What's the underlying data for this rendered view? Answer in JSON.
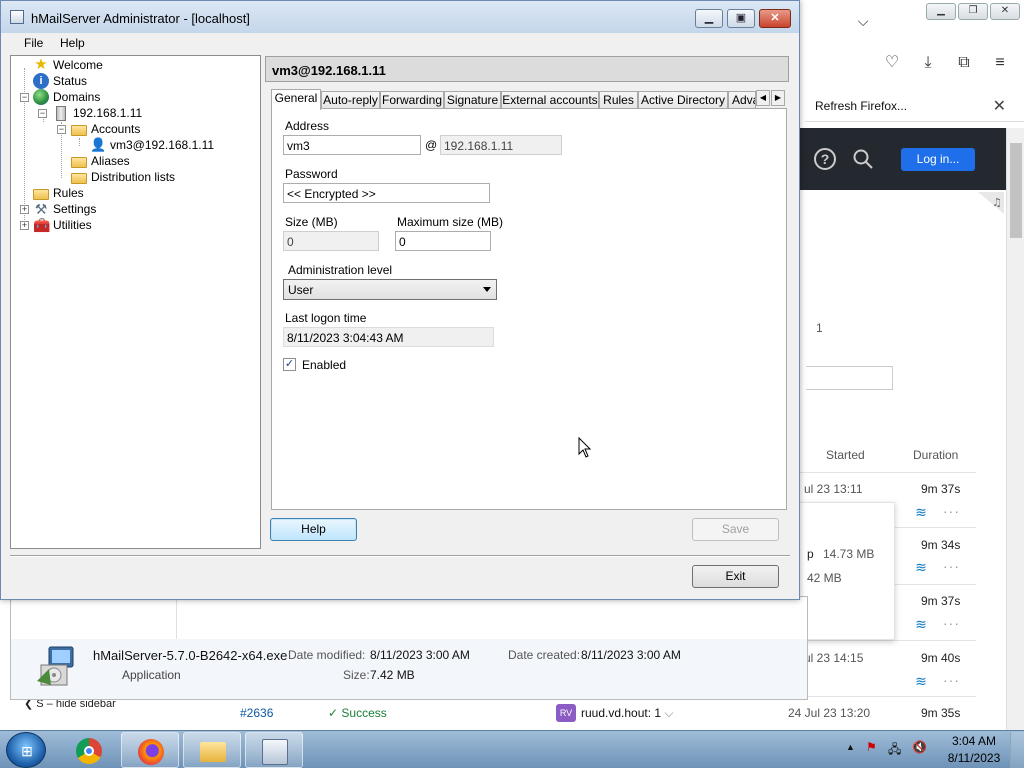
{
  "app": {
    "title": "hMailServer Administrator - [localhost]",
    "menu": [
      "File",
      "Help"
    ]
  },
  "tree": {
    "items": [
      {
        "label": "Welcome",
        "icon": "star-icon"
      },
      {
        "label": "Status",
        "icon": "info-icon"
      },
      {
        "label": "Domains",
        "icon": "globe-icon"
      },
      {
        "label": "192.168.1.11",
        "icon": "server-icon"
      },
      {
        "label": "Accounts",
        "icon": "folder-icon"
      },
      {
        "label": "vm3@192.168.1.11",
        "icon": "user-icon"
      },
      {
        "label": "Aliases",
        "icon": "folder-icon"
      },
      {
        "label": "Distribution lists",
        "icon": "folder-icon"
      },
      {
        "label": "Rules",
        "icon": "folder-icon"
      },
      {
        "label": "Settings",
        "icon": "tools-icon"
      },
      {
        "label": "Utilities",
        "icon": "utilities-icon"
      }
    ]
  },
  "account": {
    "header": "vm3@192.168.1.11",
    "tabs": [
      "General",
      "Auto-reply",
      "Forwarding",
      "Signature",
      "External accounts",
      "Rules",
      "Active Directory",
      "Adva"
    ],
    "active_tab": "General",
    "address_label": "Address",
    "address_value": "vm3",
    "at_sign": "@",
    "domain_value": "192.168.1.11",
    "password_label": "Password",
    "password_value": "<< Encrypted >>",
    "size_label": "Size (MB)",
    "size_value": "0",
    "max_size_label": "Maximum size (MB)",
    "max_size_value": "0",
    "admin_level_label": "Administration level",
    "admin_level_value": "User",
    "last_logon_label": "Last logon time",
    "last_logon_value": "8/11/2023 3:04:43 AM",
    "enabled_label": "Enabled",
    "enabled": true
  },
  "buttons": {
    "help": "Help",
    "save": "Save",
    "exit": "Exit"
  },
  "browser": {
    "tab_title": "Refresh Firefox...",
    "login": "Log in...",
    "page_number": "1",
    "col_started": "Started",
    "col_duration": "Duration",
    "rows": [
      {
        "started": "ul 23 13:11",
        "duration": "9m 37s"
      },
      {
        "started": "",
        "duration": "9m 34s"
      },
      {
        "started": "",
        "duration": "9m 37s"
      },
      {
        "started": "ul 23 14:15",
        "duration": "9m 40s"
      }
    ],
    "popup_size1": "14.73 MB",
    "popup_size2": "42 MB",
    "popup_prefix": "p",
    "last_run": {
      "number": "#2636",
      "status": "Success",
      "avatar": "RV",
      "user": "ruud.vd.hout: 1",
      "started": "24 Jul 23 13:20",
      "duration": "9m 35s"
    },
    "sidebar_toggle": "S – hide sidebar"
  },
  "explorer": {
    "file_name": "hMailServer-5.7.0-B2642-x64.exe",
    "file_type": "Application",
    "date_modified_label": "Date modified:",
    "date_modified": "8/11/2023 3:00 AM",
    "date_created_label": "Date created:",
    "date_created": "8/11/2023 3:00 AM",
    "size_label": "Size:",
    "size": "7.42 MB"
  },
  "taskbar": {
    "time": "3:04 AM",
    "date": "8/11/2023"
  },
  "colors": {
    "accent_blue": "#1f6feb",
    "success_green": "#1a7f37",
    "title_bar": "#c4d6ea"
  }
}
